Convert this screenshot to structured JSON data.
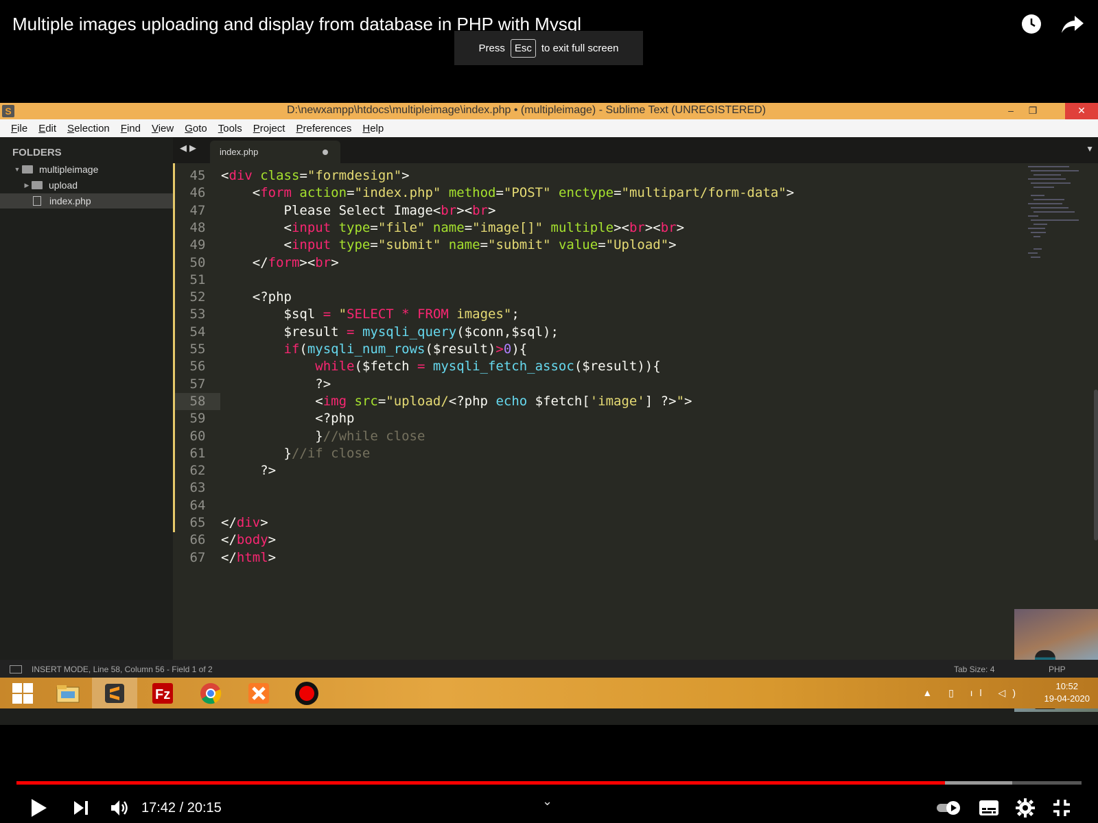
{
  "video": {
    "title": "Multiple images uploading and display from database in PHP with Mysql",
    "esc_press": "Press",
    "esc_key": "Esc",
    "esc_text": "to exit full screen",
    "time": "17:42 / 20:15",
    "progress_played": 0.872,
    "progress_loaded": 0.935
  },
  "window": {
    "title": "D:\\newxampp\\htdocs\\multipleimage\\index.php • (multipleimage) - Sublime Text (UNREGISTERED)",
    "minimize": "–",
    "restore": "❐",
    "close": "✕"
  },
  "menu": [
    "File",
    "Edit",
    "Selection",
    "Find",
    "View",
    "Goto",
    "Tools",
    "Project",
    "Preferences",
    "Help"
  ],
  "sidebar": {
    "header": "FOLDERS",
    "items": [
      {
        "label": "multipleimage",
        "type": "folder",
        "expanded": true
      },
      {
        "label": "upload",
        "type": "folder",
        "expanded": false
      },
      {
        "label": "index.php",
        "type": "file",
        "selected": true
      }
    ]
  },
  "tab": {
    "label": "index.php",
    "dirty": true
  },
  "editor": {
    "current_line": 58,
    "lines": [
      {
        "n": "45",
        "tokens": [
          [
            "pl",
            "<"
          ],
          [
            "tag",
            "div"
          ],
          [
            "pl",
            " "
          ],
          [
            "attr",
            "class"
          ],
          [
            "pl",
            "="
          ],
          [
            "str",
            "\"formdesign\""
          ],
          [
            "pl",
            ">"
          ]
        ]
      },
      {
        "n": "46",
        "tokens": [
          [
            "pl",
            "    <"
          ],
          [
            "tag",
            "form"
          ],
          [
            "pl",
            " "
          ],
          [
            "attr",
            "action"
          ],
          [
            "pl",
            "="
          ],
          [
            "str",
            "\"index.php\""
          ],
          [
            "pl",
            " "
          ],
          [
            "attr",
            "method"
          ],
          [
            "pl",
            "="
          ],
          [
            "str",
            "\"POST\""
          ],
          [
            "pl",
            " "
          ],
          [
            "attr",
            "enctype"
          ],
          [
            "pl",
            "="
          ],
          [
            "str",
            "\"multipart/form-data\""
          ],
          [
            "pl",
            ">"
          ]
        ]
      },
      {
        "n": "47",
        "tokens": [
          [
            "pl",
            "        Please Select Image<"
          ],
          [
            "tag",
            "br"
          ],
          [
            "pl",
            "><"
          ],
          [
            "tag",
            "br"
          ],
          [
            "pl",
            ">"
          ]
        ]
      },
      {
        "n": "48",
        "tokens": [
          [
            "pl",
            "        <"
          ],
          [
            "tag",
            "input"
          ],
          [
            "pl",
            " "
          ],
          [
            "attr",
            "type"
          ],
          [
            "pl",
            "="
          ],
          [
            "str",
            "\"file\""
          ],
          [
            "pl",
            " "
          ],
          [
            "attr",
            "name"
          ],
          [
            "pl",
            "="
          ],
          [
            "str",
            "\"image[]\""
          ],
          [
            "pl",
            " "
          ],
          [
            "attr",
            "multiple"
          ],
          [
            "pl",
            "><"
          ],
          [
            "tag",
            "br"
          ],
          [
            "pl",
            "><"
          ],
          [
            "tag",
            "br"
          ],
          [
            "pl",
            ">"
          ]
        ]
      },
      {
        "n": "49",
        "tokens": [
          [
            "pl",
            "        <"
          ],
          [
            "tag",
            "input"
          ],
          [
            "pl",
            " "
          ],
          [
            "attr",
            "type"
          ],
          [
            "pl",
            "="
          ],
          [
            "str",
            "\"submit\""
          ],
          [
            "pl",
            " "
          ],
          [
            "attr",
            "name"
          ],
          [
            "pl",
            "="
          ],
          [
            "str",
            "\"submit\""
          ],
          [
            "pl",
            " "
          ],
          [
            "attr",
            "value"
          ],
          [
            "pl",
            "="
          ],
          [
            "str",
            "\"Upload\""
          ],
          [
            "pl",
            ">"
          ]
        ]
      },
      {
        "n": "50",
        "tokens": [
          [
            "pl",
            "    </"
          ],
          [
            "tag",
            "form"
          ],
          [
            "pl",
            "><"
          ],
          [
            "tag",
            "br"
          ],
          [
            "pl",
            ">"
          ]
        ]
      },
      {
        "n": "51",
        "tokens": []
      },
      {
        "n": "52",
        "tokens": [
          [
            "pl",
            "    <?php"
          ]
        ]
      },
      {
        "n": "53",
        "tokens": [
          [
            "pl",
            "        $sql "
          ],
          [
            "kw",
            "="
          ],
          [
            "pl",
            " "
          ],
          [
            "str",
            "\""
          ],
          [
            "kw",
            "SELECT"
          ],
          [
            "str",
            " "
          ],
          [
            "kw",
            "*"
          ],
          [
            "str",
            " "
          ],
          [
            "kw",
            "FROM"
          ],
          [
            "str",
            " images\""
          ],
          [
            "pl",
            ";"
          ]
        ]
      },
      {
        "n": "54",
        "tokens": [
          [
            "pl",
            "        $result "
          ],
          [
            "kw",
            "="
          ],
          [
            "pl",
            " "
          ],
          [
            "fn",
            "mysqli_query"
          ],
          [
            "pl",
            "($conn,$sql);"
          ]
        ]
      },
      {
        "n": "55",
        "tokens": [
          [
            "pl",
            "        "
          ],
          [
            "kw",
            "if"
          ],
          [
            "pl",
            "("
          ],
          [
            "fn",
            "mysqli_num_rows"
          ],
          [
            "pl",
            "($result)"
          ],
          [
            "kw",
            ">"
          ],
          [
            "num",
            "0"
          ],
          [
            "pl",
            "){"
          ]
        ]
      },
      {
        "n": "56",
        "tokens": [
          [
            "pl",
            "            "
          ],
          [
            "kw",
            "while"
          ],
          [
            "pl",
            "($fetch "
          ],
          [
            "kw",
            "="
          ],
          [
            "pl",
            " "
          ],
          [
            "fn",
            "mysqli_fetch_assoc"
          ],
          [
            "pl",
            "($result)){"
          ]
        ]
      },
      {
        "n": "57",
        "tokens": [
          [
            "pl",
            "            ?>"
          ]
        ]
      },
      {
        "n": "58",
        "tokens": [
          [
            "pl",
            "            <"
          ],
          [
            "tag",
            "img"
          ],
          [
            "pl",
            " "
          ],
          [
            "attr",
            "src"
          ],
          [
            "pl",
            "="
          ],
          [
            "str",
            "\"upload/"
          ],
          [
            "pl",
            "<?php "
          ],
          [
            "fn",
            "echo"
          ],
          [
            "pl",
            " $fetch["
          ],
          [
            "str",
            "'image'"
          ],
          [
            "pl",
            "] ?>"
          ],
          [
            "str",
            "\""
          ],
          [
            "pl",
            ">"
          ]
        ]
      },
      {
        "n": "59",
        "tokens": [
          [
            "pl",
            "            <?php"
          ]
        ]
      },
      {
        "n": "60",
        "tokens": [
          [
            "pl",
            "            }"
          ],
          [
            "cm",
            "//while close"
          ]
        ]
      },
      {
        "n": "61",
        "tokens": [
          [
            "pl",
            "        }"
          ],
          [
            "cm",
            "//if close"
          ]
        ]
      },
      {
        "n": "62",
        "tokens": [
          [
            "pl",
            "     ?>"
          ]
        ]
      },
      {
        "n": "63",
        "tokens": []
      },
      {
        "n": "64",
        "tokens": []
      },
      {
        "n": "65",
        "tokens": [
          [
            "pl",
            "</"
          ],
          [
            "tag",
            "div"
          ],
          [
            "pl",
            ">"
          ]
        ]
      },
      {
        "n": "66",
        "tokens": [
          [
            "pl",
            "</"
          ],
          [
            "tag",
            "body"
          ],
          [
            "pl",
            ">"
          ]
        ]
      },
      {
        "n": "67",
        "tokens": [
          [
            "pl",
            "</"
          ],
          [
            "tag",
            "html"
          ],
          [
            "pl",
            ">"
          ]
        ]
      }
    ]
  },
  "status": {
    "left": "INSERT MODE, Line 58, Column 56 - Field 1 of 2",
    "tab_size": "Tab Size: 4",
    "syntax": "PHP"
  },
  "taskbar": {
    "apps": [
      "windows-start",
      "file-explorer",
      "sublime-text",
      "filezilla",
      "chrome",
      "xampp",
      "screen-recorder"
    ],
    "clock_time": "10:52",
    "clock_date": "19-04-2020"
  },
  "colors": {
    "titlebar": "#f0b155",
    "editor_bg": "#282923",
    "progress": "#ff0000"
  }
}
